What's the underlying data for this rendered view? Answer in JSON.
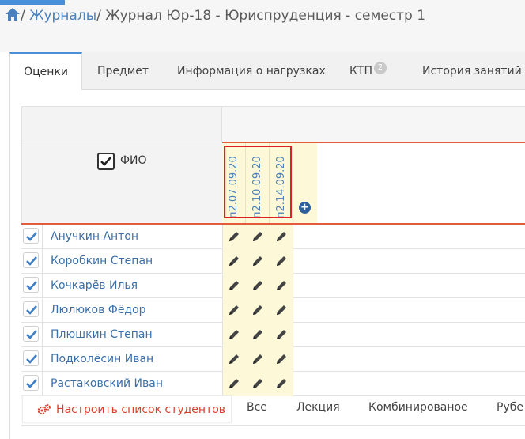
{
  "breadcrumb": {
    "items": [
      "Журналы",
      "Журнал Юр-18 - Юриспруденция - семестр 1"
    ]
  },
  "tabs": [
    {
      "label": "Оценки",
      "active": true
    },
    {
      "label": "Предмет"
    },
    {
      "label": "Информация о нагрузках"
    },
    {
      "label": "КТП",
      "badge": "2"
    },
    {
      "label": "История занятий"
    }
  ],
  "table": {
    "fio_header": "ФИО",
    "dates": [
      "п2.07.09.20",
      "п2.10.09.20",
      "п2.14.09.20"
    ],
    "students": [
      "Анучкин Антон",
      "Коробкин Степан",
      "Кочкарёв Илья",
      "Люлюков Фёдор",
      "Плюшкин Степан",
      "Подколёсин Иван",
      "Растаковский Иван"
    ]
  },
  "footer": {
    "config_button": "Настроить список студентов",
    "filters": [
      "Все",
      "Лекция",
      "Комбинированое",
      "Рубе"
    ]
  },
  "colors": {
    "accent": "#4a90d9",
    "link": "#3a6fa8",
    "highlight_red": "#e02020",
    "grade_bg": "#fdf8d8"
  }
}
